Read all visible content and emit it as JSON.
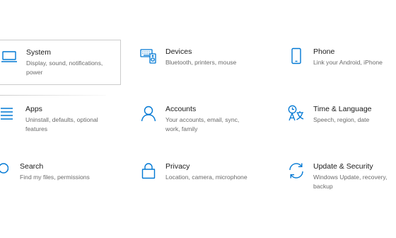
{
  "accent_color": "#0078d4",
  "tiles": [
    {
      "key": "system",
      "title": "System",
      "desc": [
        "Display, sound, notifications,",
        "power"
      ],
      "icon": "laptop-icon",
      "selected": true
    },
    {
      "key": "devices",
      "title": "Devices",
      "desc": [
        "Bluetooth, printers, mouse"
      ],
      "icon": "keyboard-speaker-icon",
      "selected": false
    },
    {
      "key": "phone",
      "title": "Phone",
      "desc": [
        "Link your Android, iPhone"
      ],
      "icon": "phone-icon",
      "selected": false
    },
    {
      "key": "apps",
      "title": "Apps",
      "desc": [
        "Uninstall, defaults, optional",
        "features"
      ],
      "icon": "apps-list-icon",
      "selected": false
    },
    {
      "key": "accounts",
      "title": "Accounts",
      "desc": [
        "Your accounts, email, sync,",
        "work, family"
      ],
      "icon": "person-icon",
      "selected": false
    },
    {
      "key": "time-language",
      "title": "Time & Language",
      "desc": [
        "Speech, region, date"
      ],
      "icon": "language-icon",
      "selected": false
    },
    {
      "key": "search",
      "title": "Search",
      "desc": [
        "Find my files, permissions"
      ],
      "icon": "search-icon",
      "selected": false
    },
    {
      "key": "privacy",
      "title": "Privacy",
      "desc": [
        "Location, camera, microphone"
      ],
      "icon": "lock-icon",
      "selected": false
    },
    {
      "key": "update-security",
      "title": "Update & Security",
      "desc": [
        "Windows Update, recovery,",
        "backup"
      ],
      "icon": "sync-arrows-icon",
      "selected": false
    }
  ]
}
